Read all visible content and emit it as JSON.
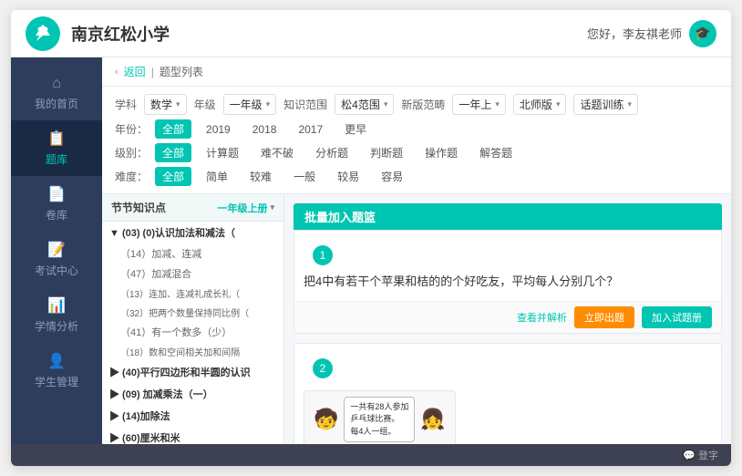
{
  "app": {
    "title": "南京红松小学",
    "logo_alt": "tree-logo"
  },
  "header": {
    "greeting": "您好，李友祺老师",
    "avatar_icon": "🎓"
  },
  "sidebar": {
    "items": [
      {
        "id": "home",
        "label": "我的首页",
        "icon": "⌂",
        "active": false
      },
      {
        "id": "questions",
        "label": "题库",
        "icon": "📋",
        "active": true
      },
      {
        "id": "papers",
        "label": "卷库",
        "icon": "📄",
        "active": false
      },
      {
        "id": "exam",
        "label": "考试中心",
        "icon": "📝",
        "active": false
      },
      {
        "id": "analysis",
        "label": "学情分析",
        "icon": "📊",
        "active": false
      },
      {
        "id": "student",
        "label": "学生管理",
        "icon": "👤",
        "active": false
      }
    ]
  },
  "breadcrumb": {
    "back": "返回",
    "current": "题型列表"
  },
  "filters": {
    "row1": {
      "subject_label": "学科",
      "subject_value": "数学",
      "grade_label": "年级",
      "grade_value": "一年级",
      "scope_label": "知识范围",
      "scope_value": "松4范围",
      "version_label": "新版范畴",
      "version_options": [
        "一年上",
        "北师版",
        "话题训练"
      ]
    },
    "row2": {
      "label": "年份：",
      "options": [
        "全部",
        "2019",
        "2018",
        "2017",
        "更早"
      ]
    },
    "row3": {
      "label": "级别：",
      "options": [
        "全部",
        "计算题",
        "难不破",
        "分析题",
        "判断题",
        "操作题",
        "解答题"
      ]
    },
    "row4": {
      "label": "难度：",
      "options": [
        "全部",
        "简单",
        "较难",
        "一般",
        "较易",
        "容易"
      ]
    }
  },
  "left_panel": {
    "header": "节节知识点",
    "grade": "一年级上册",
    "tree": [
      {
        "type": "parent",
        "text": "▼ (03) (0)认识加法和减法（（",
        "indent": 0
      },
      {
        "type": "child",
        "text": "（14）加减、连减",
        "indent": 1
      },
      {
        "type": "child",
        "text": "（47）加减混合",
        "indent": 1
      },
      {
        "type": "child",
        "text": "（13）连加、连减礼成长礼（",
        "indent": 1
      },
      {
        "type": "child",
        "text": "（32）把两个数量保持同比例（",
        "indent": 1
      },
      {
        "type": "child",
        "text": "（41）有一个数多（少）",
        "indent": 1
      },
      {
        "type": "child",
        "text": "（18）数和空间相关加和间隔",
        "indent": 1
      },
      {
        "type": "parent",
        "text": "▶ (40)平行四边形和半圆的认识",
        "indent": 0
      },
      {
        "type": "parent",
        "text": "▶ (09) 加减乘法（一）",
        "indent": 0
      },
      {
        "type": "parent",
        "text": "▶ (14)加除法",
        "indent": 0
      },
      {
        "type": "parent",
        "text": "▶ (60)厘米和米",
        "indent": 0
      }
    ]
  },
  "right_panel": {
    "header": "批量加入题篮",
    "questions": [
      {
        "number": "1",
        "text": "把4中有若干个苹果和桔的的个好吃友，平均每人分别几个？",
        "has_actions": true,
        "actions": [
          "查看并解析",
          "立即出题",
          "加入试题册"
        ]
      },
      {
        "number": "2",
        "text": "",
        "has_image": true,
        "image_lines": [
          "一共有28人参加",
          "乒乓球比赛。",
          "每4人一组。"
        ],
        "has_actions": false
      }
    ]
  },
  "wechat": {
    "label": "登字"
  }
}
